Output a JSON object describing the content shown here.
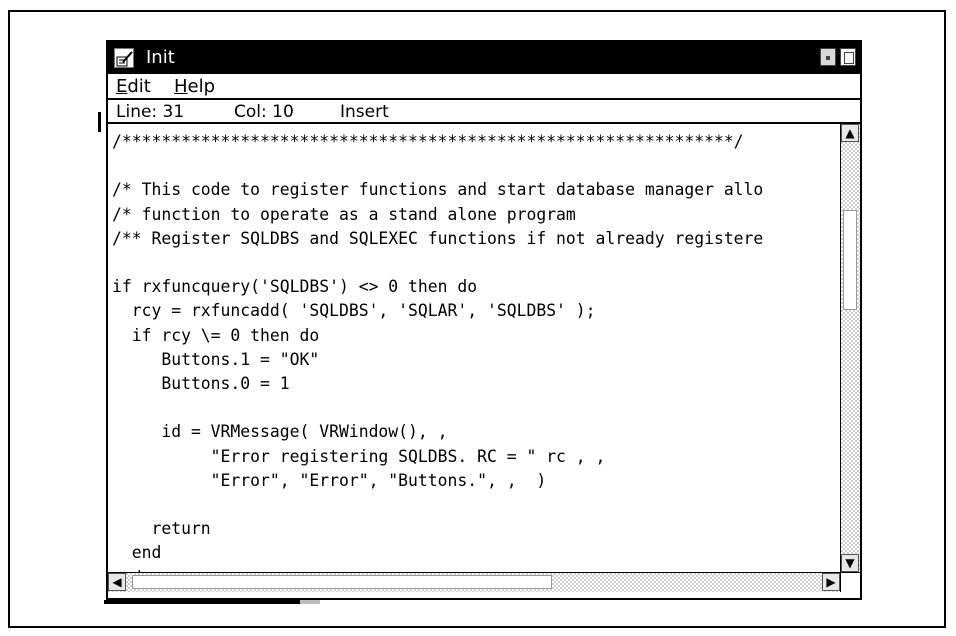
{
  "window": {
    "title": "Init"
  },
  "menubar": {
    "edit": {
      "underline": "E",
      "rest": "dit"
    },
    "help": {
      "underline": "H",
      "rest": "elp"
    }
  },
  "status": {
    "line": "Line: 31",
    "col": "Col: 10",
    "mode": "Insert"
  },
  "editor": {
    "lines": [
      "/**************************************************************/",
      "",
      "/* This code to register functions and start database manager allo",
      "/* function to operate as a stand alone program",
      "/** Register SQLDBS and SQLEXEC functions if not already registere",
      "",
      "if rxfuncquery('SQLDBS') <> 0 then do",
      "  rcy = rxfuncadd( 'SQLDBS', 'SQLAR', 'SQLDBS' );",
      "  if rcy \\= 0 then do",
      "     Buttons.1 = \"OK\"",
      "     Buttons.0 = 1",
      "",
      "     id = VRMessage( VRWindow(), ,",
      "          \"Error registering SQLDBS. RC = \" rc , ,",
      "          \"Error\", \"Error\", \"Buttons.\", ,  )",
      "",
      "    return",
      "  end",
      "end"
    ]
  },
  "icons": {
    "system_menu": "pen-document-icon",
    "minimize": "minimize-icon",
    "maximize": "maximize-icon",
    "scroll_up": "scroll-up-arrow-icon",
    "scroll_down": "scroll-down-arrow-icon",
    "scroll_left": "scroll-left-arrow-icon",
    "scroll_right": "scroll-right-arrow-icon"
  }
}
